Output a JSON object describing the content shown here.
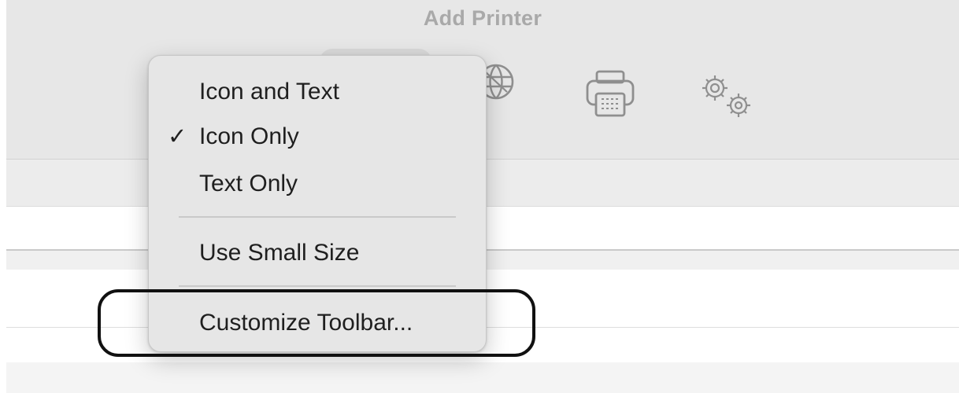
{
  "window": {
    "title": "Add Printer"
  },
  "toolbar": {
    "icons": [
      "globe-icon",
      "printer-icon",
      "gears-icon"
    ]
  },
  "context_menu": {
    "items": [
      {
        "label": "Icon and Text",
        "checked": false
      },
      {
        "label": "Icon Only",
        "checked": true,
        "check_mark": "✓"
      },
      {
        "label": "Text Only",
        "checked": false
      },
      {
        "label": "Use Small Size",
        "checked": false
      },
      {
        "label": "Customize Toolbar...",
        "checked": false
      }
    ]
  },
  "annotation": {
    "highlighted_item": "Customize Toolbar...",
    "ring_color": "#111111"
  }
}
